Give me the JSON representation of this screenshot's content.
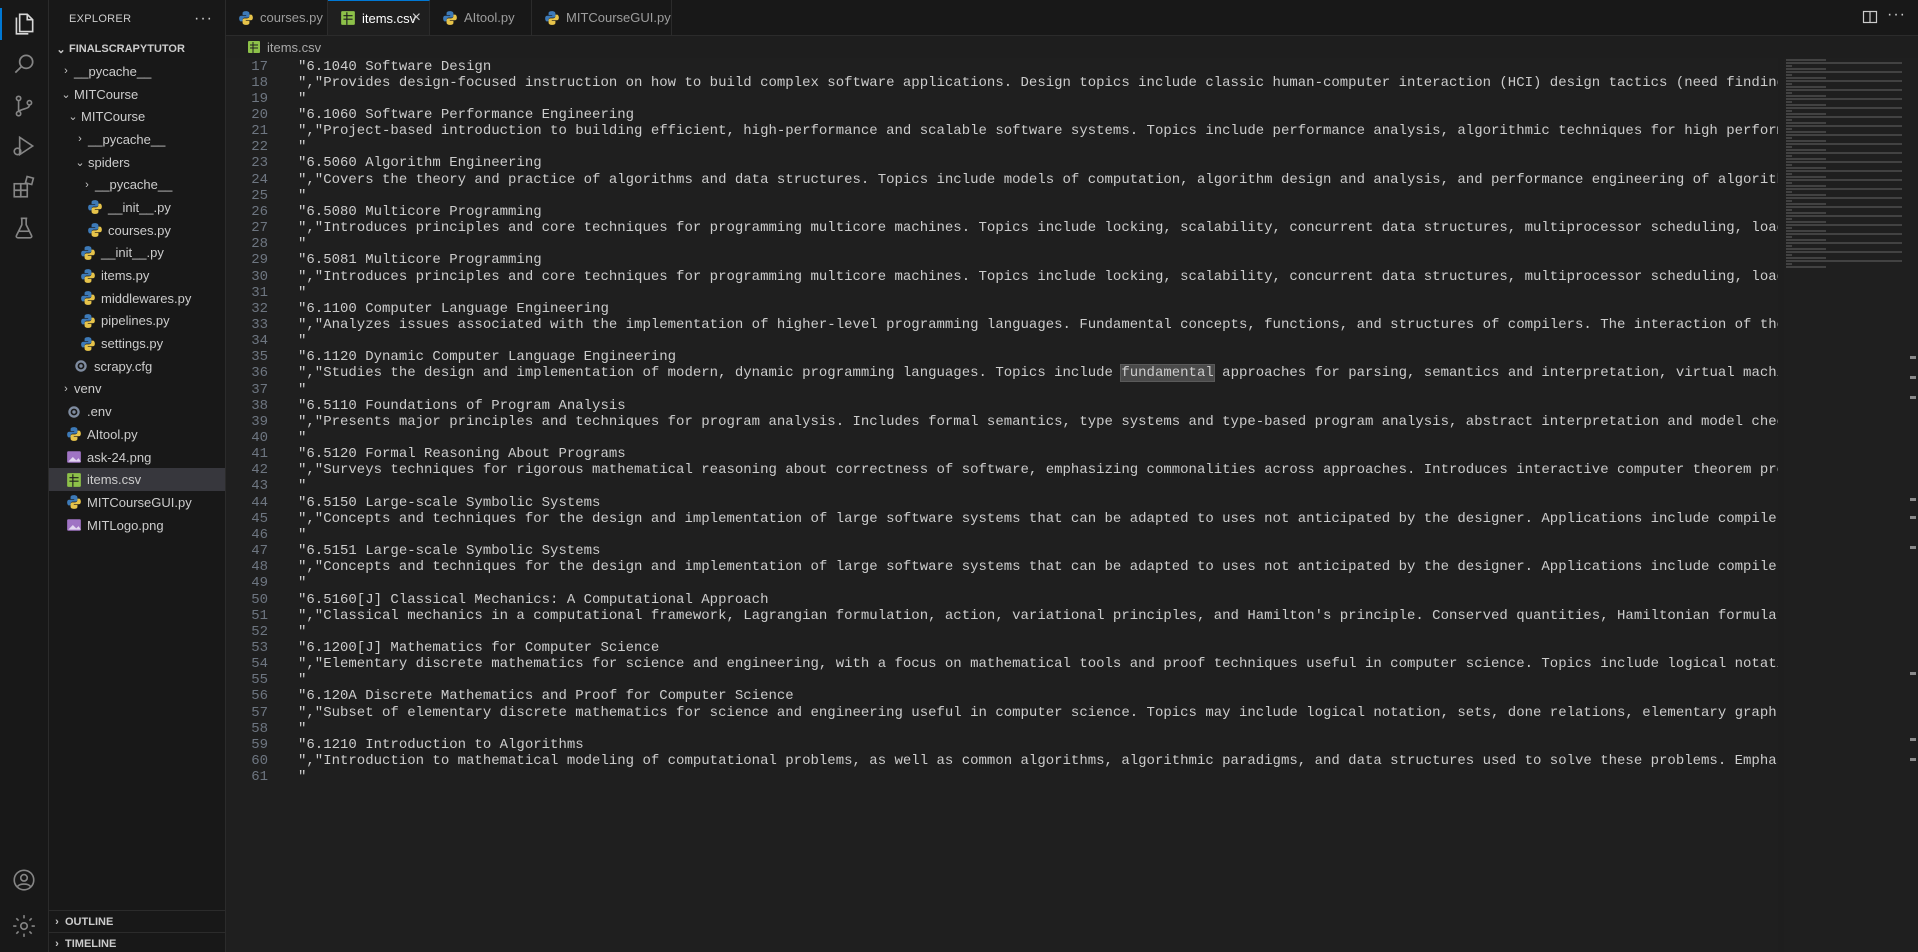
{
  "sidebar": {
    "title": "EXPLORER",
    "more": "···",
    "root": "FINALSCRAPYTUTOR",
    "items": [
      {
        "label": "__pycache__",
        "type": "folder",
        "open": false,
        "indent": 1
      },
      {
        "label": "MITCourse",
        "type": "folder",
        "open": true,
        "indent": 1
      },
      {
        "label": "MITCourse",
        "type": "folder",
        "open": true,
        "indent": 2
      },
      {
        "label": "__pycache__",
        "type": "folder",
        "open": false,
        "indent": 3
      },
      {
        "label": "spiders",
        "type": "folder",
        "open": true,
        "indent": 3
      },
      {
        "label": "__pycache__",
        "type": "folder",
        "open": false,
        "indent": 4
      },
      {
        "label": "__init__.py",
        "type": "py",
        "indent": 4
      },
      {
        "label": "courses.py",
        "type": "py",
        "indent": 4
      },
      {
        "label": "__init__.py",
        "type": "py",
        "indent": 3
      },
      {
        "label": "items.py",
        "type": "py",
        "indent": 3
      },
      {
        "label": "middlewares.py",
        "type": "py",
        "indent": 3
      },
      {
        "label": "pipelines.py",
        "type": "py",
        "indent": 3
      },
      {
        "label": "settings.py",
        "type": "py",
        "indent": 3
      },
      {
        "label": "scrapy.cfg",
        "type": "cfg",
        "indent": 2
      },
      {
        "label": "venv",
        "type": "folder",
        "open": false,
        "indent": 1
      },
      {
        "label": ".env",
        "type": "env",
        "indent": 1
      },
      {
        "label": "AItool.py",
        "type": "py",
        "indent": 1
      },
      {
        "label": "ask-24.png",
        "type": "png",
        "indent": 1
      },
      {
        "label": "items.csv",
        "type": "csv",
        "indent": 1,
        "selected": true
      },
      {
        "label": "MITCourseGUI.py",
        "type": "py",
        "indent": 1
      },
      {
        "label": "MITLogo.png",
        "type": "png",
        "indent": 1
      }
    ],
    "outline": "OUTLINE",
    "timeline": "TIMELINE"
  },
  "tabs": [
    {
      "label": "courses.py",
      "type": "py",
      "active": false
    },
    {
      "label": "items.csv",
      "type": "csv",
      "active": true
    },
    {
      "label": "AItool.py",
      "type": "py",
      "active": false
    },
    {
      "label": "MITCourseGUI.py",
      "type": "py",
      "active": false
    }
  ],
  "tab_close": "×",
  "tab_more": "···",
  "breadcrumb": "items.csv",
  "highlight_word": "fundamental",
  "lines": [
    {
      "n": "17",
      "text": "\"6.1040 Software Design"
    },
    {
      "n": "18",
      "text": "\",\"Provides design-focused instruction on how to build complex software applications. Design topics include classic human-computer interaction (HCI) design tactics (need finding, heurist"
    },
    {
      "n": "19",
      "text": "\""
    },
    {
      "n": "20",
      "text": "\"6.1060 Software Performance Engineering"
    },
    {
      "n": "21",
      "text": "\",\"Project-based introduction to building efficient, high-performance and scalable software systems. Topics include performance analysis, algorithmic techniques for high performance, ins"
    },
    {
      "n": "22",
      "text": "\""
    },
    {
      "n": "23",
      "text": "\"6.5060 Algorithm Engineering"
    },
    {
      "n": "24",
      "text": "\",\"Covers the theory and practice of algorithms and data structures. Topics include models of computation, algorithm design and analysis, and performance engineering of algorithm impleme"
    },
    {
      "n": "25",
      "text": "\""
    },
    {
      "n": "26",
      "text": "\"6.5080 Multicore Programming"
    },
    {
      "n": "27",
      "text": "\",\"Introduces principles and core techniques for programming multicore machines. Topics include locking, scalability, concurrent data structures, multiprocessor scheduling, load balancin"
    },
    {
      "n": "28",
      "text": "\""
    },
    {
      "n": "29",
      "text": "\"6.5081 Multicore Programming"
    },
    {
      "n": "30",
      "text": "\",\"Introduces principles and core techniques for programming multicore machines. Topics include locking, scalability, concurrent data structures, multiprocessor scheduling, load balancin"
    },
    {
      "n": "31",
      "text": "\""
    },
    {
      "n": "32",
      "text": "\"6.1100 Computer Language Engineering"
    },
    {
      "n": "33",
      "text": "\",\"Analyzes issues associated with the implementation of higher-level programming languages. Fundamental concepts, functions, and structures of compilers. The interaction of theory and p"
    },
    {
      "n": "34",
      "text": "\""
    },
    {
      "n": "35",
      "text": "\"6.1120 Dynamic Computer Language Engineering"
    },
    {
      "n": "36",
      "text": "\",\"Studies the design and implementation of modern, dynamic programming languages. Topics include fundamental approaches for parsing, semantics and interpretation, virtual machines, garb"
    },
    {
      "n": "37",
      "text": "\""
    },
    {
      "n": "38",
      "text": "\"6.5110 Foundations of Program Analysis"
    },
    {
      "n": "39",
      "text": "\",\"Presents major principles and techniques for program analysis. Includes formal semantics, type systems and type-based program analysis, abstract interpretation and model checking and "
    },
    {
      "n": "40",
      "text": "\""
    },
    {
      "n": "41",
      "text": "\"6.5120 Formal Reasoning About Programs"
    },
    {
      "n": "42",
      "text": "\",\"Surveys techniques for rigorous mathematical reasoning about correctness of software, emphasizing commonalities across approaches. Introduces interactive computer theorem proving with"
    },
    {
      "n": "43",
      "text": "\""
    },
    {
      "n": "44",
      "text": "\"6.5150 Large-scale Symbolic Systems"
    },
    {
      "n": "45",
      "text": "\",\"Concepts and techniques for the design and implementation of large software systems that can be adapted to uses not anticipated by the designer. Applications include compilers, comput"
    },
    {
      "n": "46",
      "text": "\""
    },
    {
      "n": "47",
      "text": "\"6.5151 Large-scale Symbolic Systems"
    },
    {
      "n": "48",
      "text": "\",\"Concepts and techniques for the design and implementation of large software systems that can be adapted to uses not anticipated by the designer. Applications include compilers, comput"
    },
    {
      "n": "49",
      "text": "\""
    },
    {
      "n": "50",
      "text": "\"6.5160[J] Classical Mechanics: A Computational Approach"
    },
    {
      "n": "51",
      "text": "\",\"Classical mechanics in a computational framework, Lagrangian formulation, action, variational principles, and Hamilton's principle. Conserved quantities, Hamiltonian formulation, surf"
    },
    {
      "n": "52",
      "text": "\""
    },
    {
      "n": "53",
      "text": "\"6.1200[J] Mathematics for Computer Science"
    },
    {
      "n": "54",
      "text": "\",\"Elementary discrete mathematics for science and engineering, with a focus on mathematical tools and proof techniques useful in computer science. Topics include logical notation, sets,"
    },
    {
      "n": "55",
      "text": "\""
    },
    {
      "n": "56",
      "text": "\"6.120A Discrete Mathematics and Proof for Computer Science"
    },
    {
      "n": "57",
      "text": "\",\"Subset of elementary discrete mathematics for science and engineering useful in computer science. Topics may include logical notation, sets, done relations, elementary graph theory, s"
    },
    {
      "n": "58",
      "text": "\""
    },
    {
      "n": "59",
      "text": "\"6.1210 Introduction to Algorithms"
    },
    {
      "n": "60",
      "text": "\",\"Introduction to mathematical modeling of computational problems, as well as common algorithms, algorithmic paradigms, and data structures used to solve these problems. Emphasizes the"
    },
    {
      "n": "61",
      "text": "\""
    }
  ],
  "colors": {
    "accent": "#0078d4",
    "python": "#3d7ab8",
    "csv": "#8dc149",
    "png": "#a074c4"
  }
}
